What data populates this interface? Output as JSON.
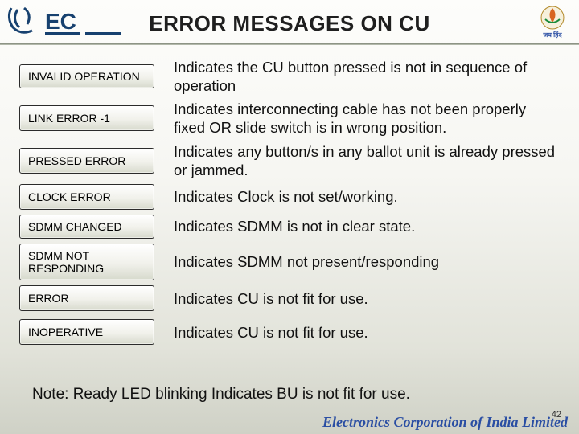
{
  "title": "ERROR MESSAGES ON CU",
  "rows": [
    {
      "label": "INVALID OPERATION",
      "desc": "Indicates the CU button pressed is not in sequence of operation"
    },
    {
      "label": "LINK ERROR -1",
      "desc": "Indicates interconnecting cable has not been properly fixed OR slide switch is in wrong position."
    },
    {
      "label": "PRESSED ERROR",
      "desc": "Indicates any button/s in any ballot unit is already pressed or jammed."
    },
    {
      "label": "CLOCK ERROR",
      "desc": "Indicates Clock is not set/working."
    },
    {
      "label": "SDMM CHANGED",
      "desc": "Indicates SDMM is not in clear state."
    },
    {
      "label": "SDMM NOT RESPONDING",
      "desc": "Indicates SDMM not present/responding"
    },
    {
      "label": "ERROR",
      "desc": "Indicates CU is not fit for use."
    },
    {
      "label": "INOPERATIVE",
      "desc": "Indicates CU is not fit for use."
    }
  ],
  "note": "Note: Ready LED blinking Indicates BU is not fit for use.",
  "footer_brand": "Electronics Corporation of India Limited",
  "page_number": "42",
  "logo_left_alt": "ECIL logo",
  "logo_right_alt": "Emblem"
}
